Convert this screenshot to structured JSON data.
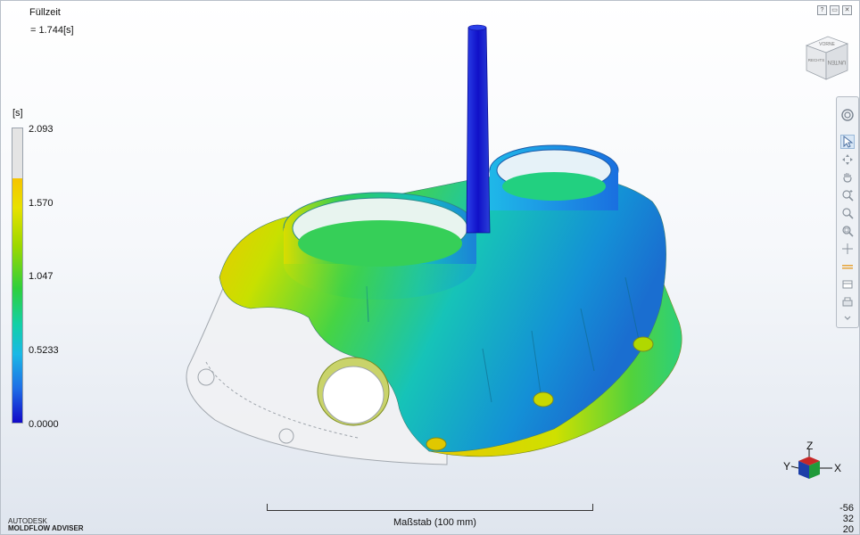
{
  "result": {
    "title": "Füllzeit",
    "equals": "=",
    "value": "1.744[s]"
  },
  "legend": {
    "unit": "[s]",
    "labels": [
      "2.093",
      "1.570",
      "1.047",
      "0.5233",
      "0.0000"
    ]
  },
  "window_buttons": [
    "?",
    "▭",
    "✕"
  ],
  "nav_cube": {
    "faces": [
      "VORNE",
      "UNTEN",
      "RECHTS"
    ]
  },
  "toolbar": {
    "tools": [
      "orbit-ring",
      "select",
      "rotate",
      "pan",
      "zoom-region",
      "zoom",
      "zoom-fit",
      "center",
      "section",
      "layers",
      "print"
    ]
  },
  "scale": {
    "label": "Maßstab (100 mm)"
  },
  "coords": [
    "-56",
    "32",
    "20"
  ],
  "brand": {
    "line1": "AUTODESK",
    "line2": "MOLDFLOW ADVISER"
  },
  "triad": {
    "z": "Z",
    "y": "Y",
    "x": "X"
  },
  "colors": {
    "accent_blue": "#1f6ee6",
    "fill_green": "#2fcf3c",
    "fill_yellow": "#e8e100"
  }
}
